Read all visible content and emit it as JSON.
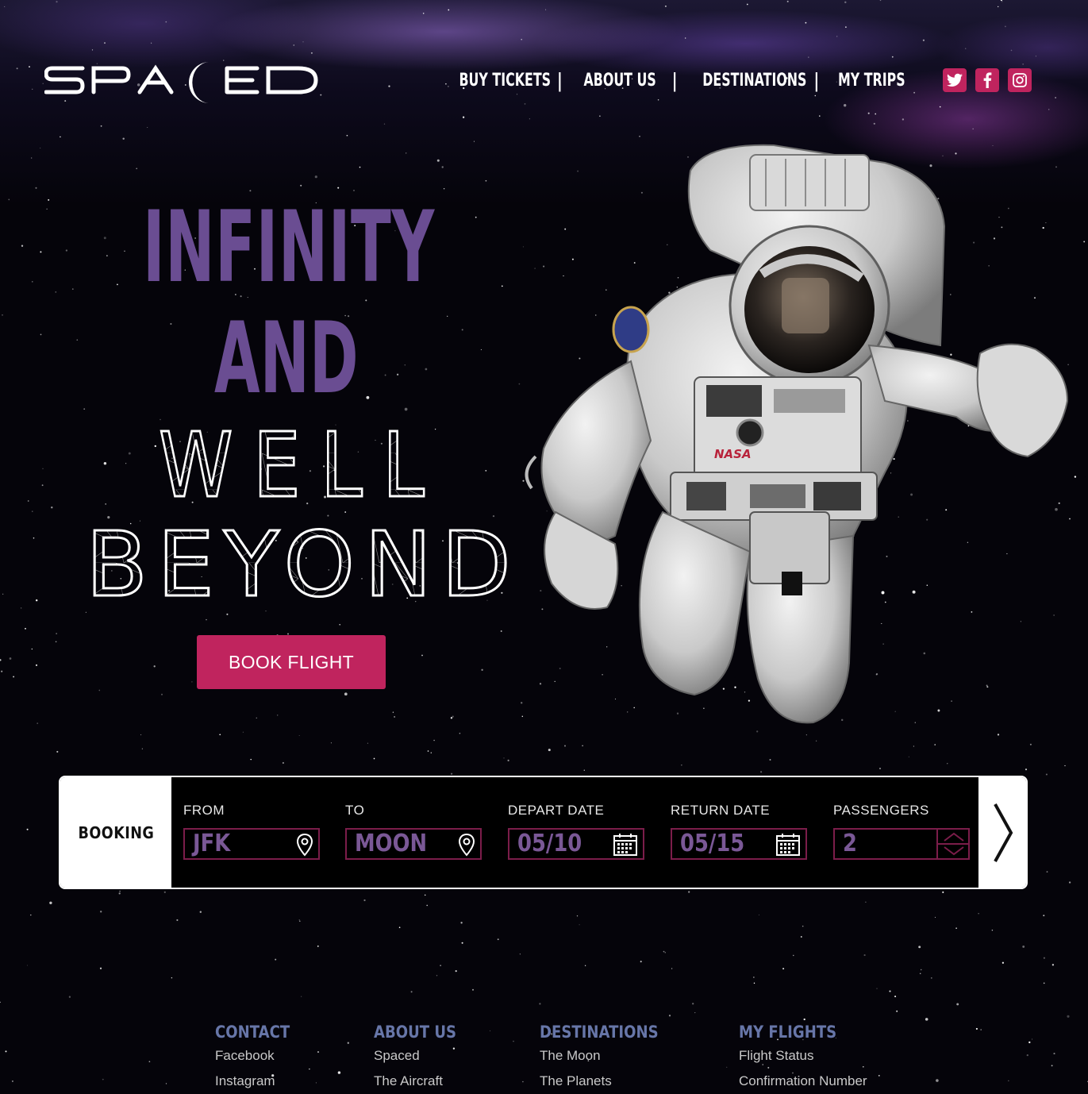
{
  "header": {
    "logo_alt": "SPACED",
    "nav": [
      "BUY TICKETS",
      "ABOUT US",
      "DESTINATIONS",
      "MY TRIPS"
    ],
    "social": [
      "twitter-icon",
      "facebook-icon",
      "instagram-icon"
    ]
  },
  "hero": {
    "line1": "INFINITY",
    "line2": "AND",
    "line3": "WELL",
    "line4": "BEYOND",
    "cta": "BOOK FLIGHT"
  },
  "booking": {
    "label": "BOOKING",
    "fields": [
      {
        "label": "FROM",
        "value": "JFK",
        "icon": "map-pin-icon"
      },
      {
        "label": "TO",
        "value": "MOON",
        "icon": "map-pin-icon"
      },
      {
        "label": "DEPART DATE",
        "value": "05/10",
        "icon": "calendar-icon"
      },
      {
        "label": "RETURN DATE",
        "value": "05/15",
        "icon": "calendar-icon"
      },
      {
        "label": "PASSENGERS",
        "value": "2",
        "icon": "stepper-icon"
      }
    ],
    "next_icon": "chevron-right-icon"
  },
  "footer": {
    "columns": [
      {
        "heading": "CONTACT",
        "links": [
          "Facebook",
          "Instagram"
        ]
      },
      {
        "heading": "ABOUT US",
        "links": [
          "Spaced",
          "The Aircraft"
        ]
      },
      {
        "heading": "DESTINATIONS",
        "links": [
          "The Moon",
          "The Planets"
        ]
      },
      {
        "heading": "MY FLIGHTS",
        "links": [
          "Flight Status",
          "Confirmation Number"
        ]
      }
    ]
  },
  "colors": {
    "accent": "#c0245e",
    "hero_purple": "#6a4d92",
    "field_border": "#7b1d4a",
    "field_text": "#7a5896",
    "footer_heading": "#6776a8",
    "background": "#05040a"
  }
}
